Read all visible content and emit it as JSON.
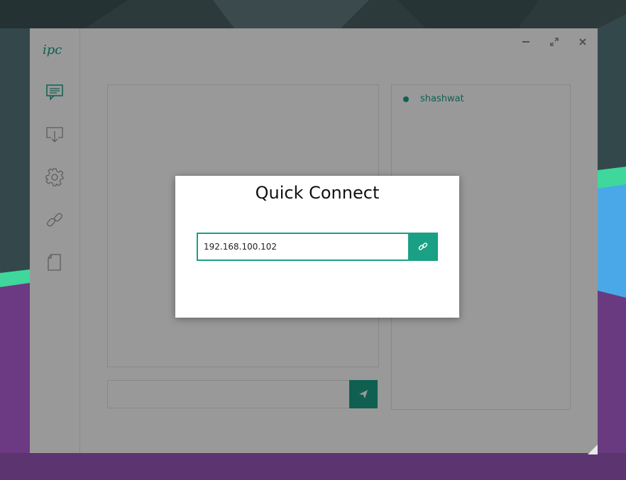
{
  "app": {
    "logo_text": "ipc",
    "accent_color": "#1aa085"
  },
  "sidebar": {
    "items": [
      {
        "name": "chat",
        "icon": "chat-icon"
      },
      {
        "name": "receive",
        "icon": "download-icon"
      },
      {
        "name": "settings",
        "icon": "gear-icon"
      },
      {
        "name": "connect",
        "icon": "link-icon"
      },
      {
        "name": "files",
        "icon": "file-icon"
      }
    ]
  },
  "window_controls": [
    "minimize-icon",
    "maximize-icon",
    "close-icon"
  ],
  "chat": {
    "message_placeholder": "",
    "send_icon": "send-icon"
  },
  "peers": {
    "list": [
      {
        "name": "shashwat",
        "status": "online"
      }
    ]
  },
  "quick_connect": {
    "title": "Quick Connect",
    "ip_value": "192.168.100.102",
    "connect_icon": "link-icon"
  }
}
